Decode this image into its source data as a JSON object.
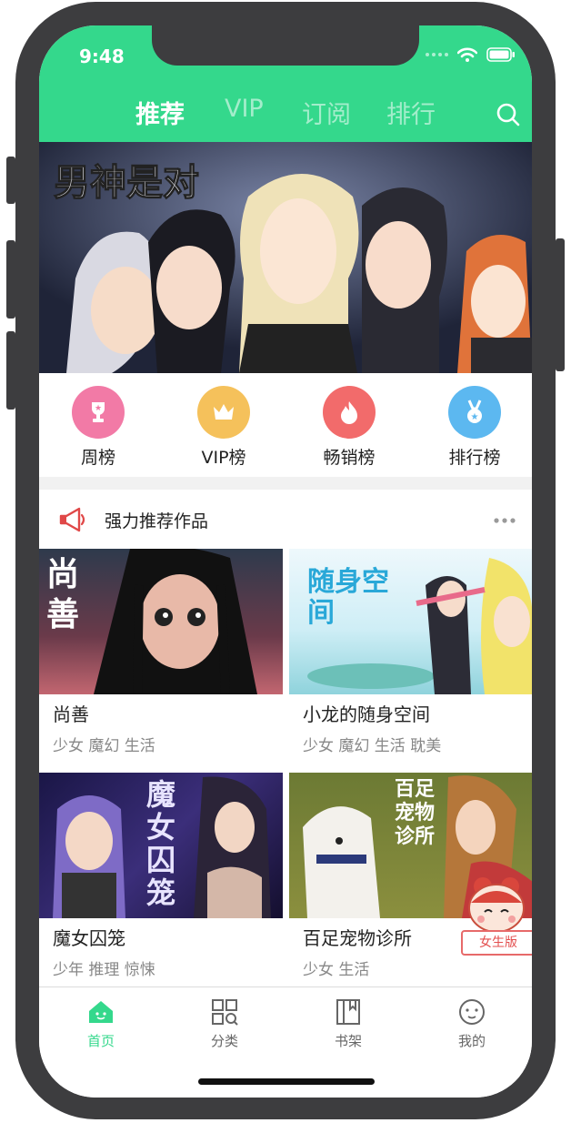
{
  "status_bar": {
    "time": "9:48"
  },
  "top_nav": {
    "tabs": [
      {
        "label": "推荐",
        "active": true
      },
      {
        "label": "VIP",
        "active": false
      },
      {
        "label": "订阅",
        "active": false
      },
      {
        "label": "排行",
        "active": false
      }
    ],
    "search_icon": "search-icon"
  },
  "banner": {
    "title_art": "男神是对"
  },
  "quick_links": [
    {
      "label": "周榜",
      "icon": "trophy-icon",
      "color": "#f27aa6"
    },
    {
      "label": "VIP榜",
      "icon": "crown-icon",
      "color": "#f5c15b"
    },
    {
      "label": "畅销榜",
      "icon": "flame-icon",
      "color": "#f26b6b"
    },
    {
      "label": "排行榜",
      "icon": "medal-icon",
      "color": "#5cb8f0"
    }
  ],
  "section": {
    "title": "强力推荐作品",
    "more_icon": "more-icon"
  },
  "comics": [
    {
      "title": "尚善",
      "tags": "少女 魔幻 生活",
      "cover_text": "尚善"
    },
    {
      "title": "小龙的随身空间",
      "tags": "少女 魔幻 生活 耽美",
      "cover_text": "随身空间"
    },
    {
      "title": "魔女囚笼",
      "tags": "少年 推理 惊悚",
      "cover_text": "魔女囚笼"
    },
    {
      "title": "百足宠物诊所",
      "tags": "少女 生活",
      "cover_text": "百足宠物诊所"
    }
  ],
  "girl_badge": {
    "label": "女生版"
  },
  "tabbar": [
    {
      "label": "首页",
      "icon": "home-icon",
      "active": true
    },
    {
      "label": "分类",
      "icon": "grid-icon",
      "active": false
    },
    {
      "label": "书架",
      "icon": "bookshelf-icon",
      "active": false
    },
    {
      "label": "我的",
      "icon": "profile-icon",
      "active": false
    }
  ],
  "colors": {
    "accent": "#34d88c",
    "tab_inactive": "#666666"
  }
}
